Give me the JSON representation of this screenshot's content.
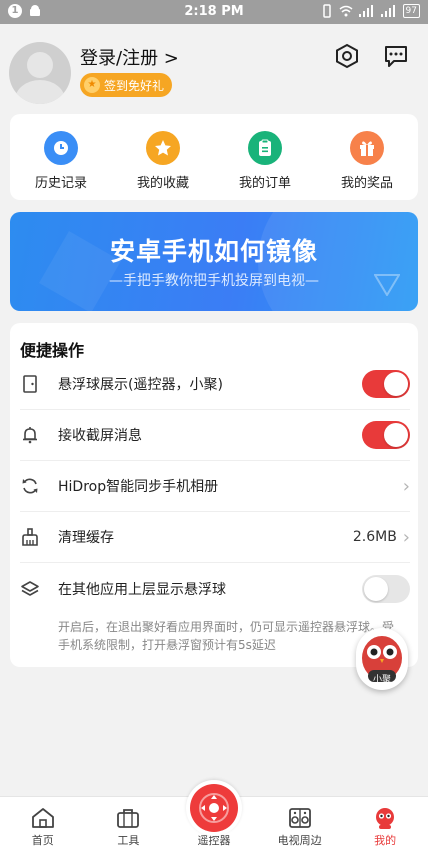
{
  "status_bar": {
    "time": "2:18 PM",
    "notif_count": "1",
    "battery": "97"
  },
  "header": {
    "login_text": "登录/注册 >",
    "signin_badge": "签到免好礼"
  },
  "quick_actions": [
    {
      "label": "历史记录",
      "icon": "clock-icon",
      "color": "#3a8ef6"
    },
    {
      "label": "我的收藏",
      "icon": "star-icon",
      "color": "#f6a623"
    },
    {
      "label": "我的订单",
      "icon": "clipboard-icon",
      "color": "#19b37a"
    },
    {
      "label": "我的奖品",
      "icon": "gift-icon",
      "color": "#f7814a"
    }
  ],
  "banner": {
    "title": "安卓手机如何镜像",
    "subtitle": "—手把手教你把手机投屏到电视—"
  },
  "settings": {
    "title": "便捷操作",
    "items": [
      {
        "label": "悬浮球展示(遥控器，小聚)",
        "control": "toggle",
        "on": true
      },
      {
        "label": "接收截屏消息",
        "control": "toggle",
        "on": true
      },
      {
        "label": "HiDrop智能同步手机相册",
        "control": "chevron"
      },
      {
        "label": "清理缓存",
        "value": "2.6MB",
        "control": "chevron"
      },
      {
        "label": "在其他应用上层显示悬浮球",
        "control": "toggle",
        "on": false
      }
    ],
    "note": "开启后，在退出聚好看应用界面时，仍可显示遥控器悬浮球。受手机系统限制，打开悬浮窗预计有5s延迟"
  },
  "floater": {
    "label": "小聚"
  },
  "tabbar": [
    {
      "label": "首页",
      "icon": "home-icon",
      "active": false
    },
    {
      "label": "工具",
      "icon": "toolbox-icon",
      "active": false
    },
    {
      "label": "遥控器",
      "icon": "remote-icon",
      "active": false
    },
    {
      "label": "电视周边",
      "icon": "speaker-icon",
      "active": false
    },
    {
      "label": "我的",
      "icon": "profile-icon",
      "active": true
    }
  ],
  "colors": {
    "accent": "#e83a3a",
    "signin": "#f6a623",
    "banner": "#3b7df5"
  }
}
